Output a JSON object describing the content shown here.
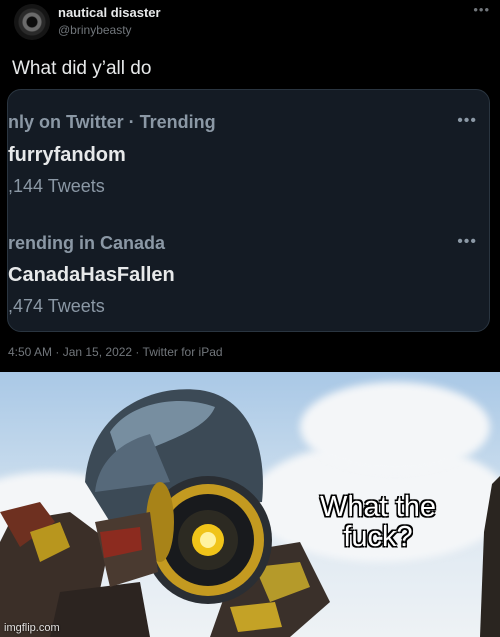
{
  "tweet": {
    "display_name": "nautical disaster",
    "handle": "@brinybeasty",
    "more_icon": "ellipsis-icon",
    "text": "What did y’all do",
    "trends": [
      {
        "context": "nly on Twitter · Trending",
        "name": "furryfandom",
        "count": ",144 Tweets"
      },
      {
        "context": "rending in Canada",
        "name": "CanadaHasFallen",
        "count": ",474 Tweets"
      }
    ],
    "trend_more": "•••",
    "meta": "4:50 AM · Jan 15, 2022 · Twitter for iPad"
  },
  "meme": {
    "caption": "What the fuck?",
    "watermark": "imgflip.com"
  },
  "colors": {
    "background": "#000000",
    "card": "#141b24",
    "primary_text": "#e7e9ea",
    "secondary_text": "#71767b"
  }
}
